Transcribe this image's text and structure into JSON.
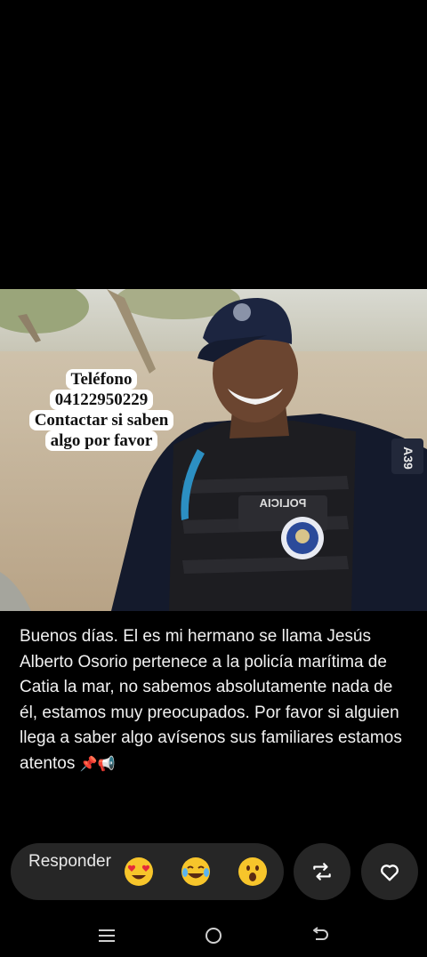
{
  "photo": {
    "overlay_lines": [
      "Teléfono",
      "04122950229",
      "Contactar si saben",
      "algo por favor"
    ],
    "vest_label": "POLICIA",
    "sleeve_label": "A39"
  },
  "caption": {
    "text": "Buenos días.  El es mi hermano se llama Jesús Alberto Osorio pertenece a la policía marítima de Catia la mar, no sabemos absolutamente nada de él, estamos muy preocupados.  Por favor si alguien llega a saber algo avísenos sus familiares estamos atentos",
    "trailing_emoji": "📌📢"
  },
  "actions": {
    "reply_label": "Responder",
    "quick_reactions": [
      "heart-eyes",
      "tears-of-joy",
      "surprised"
    ],
    "share_icon": "repeat-icon",
    "like_icon": "heart-icon"
  },
  "navigation": {
    "buttons": [
      "recent-apps",
      "home",
      "back"
    ]
  },
  "colors": {
    "background": "#000000",
    "pill": "#262626",
    "text": "#f1f1f1"
  }
}
